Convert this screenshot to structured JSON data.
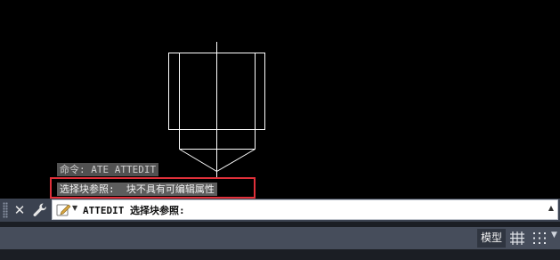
{
  "command_history": [
    "命令: ATE ATTEDIT",
    "选择块参照:  块不具有可编辑属性"
  ],
  "command_line": {
    "prompt": "ATTEDIT 选择块参照:",
    "close_label": "✕"
  },
  "status_bar": {
    "model_tab": "模型"
  },
  "colors": {
    "canvas_background": "#000000",
    "drawing_lines": "#ffffff",
    "highlight_border": "#e0303a",
    "command_bar": "#3b4250",
    "status_bar": "#464d5b"
  },
  "icons": {
    "grip": "grip-icon",
    "close": "close-icon",
    "customize": "wrench-icon",
    "recent_commands": "command-pen-icon",
    "grid": "grid-icon",
    "snap": "snap-icon"
  }
}
